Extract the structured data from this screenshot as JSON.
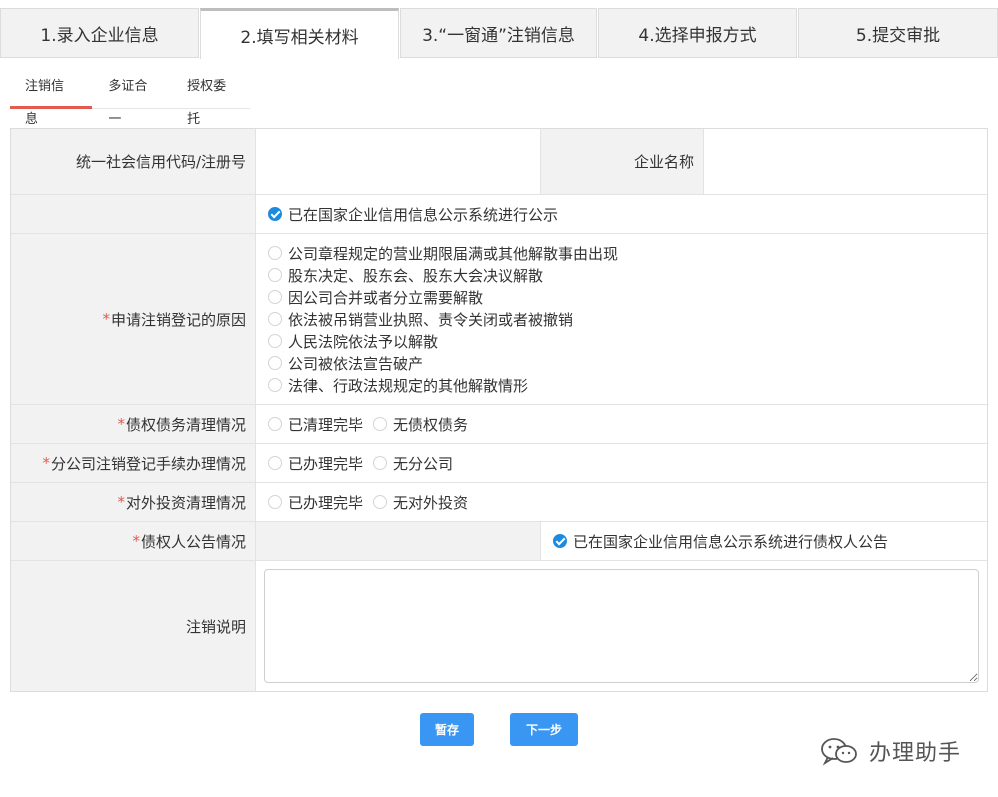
{
  "steps": [
    {
      "label": "1.录入企业信息"
    },
    {
      "label": "2.填写相关材料"
    },
    {
      "label": "3.“一窗通”注销信息"
    },
    {
      "label": "4.选择申报方式"
    },
    {
      "label": "5.提交审批"
    }
  ],
  "subtabs": [
    "注销信息",
    "多证合一",
    "授权委托"
  ],
  "form": {
    "credit_code_label": "统一社会信用代码/注册号",
    "credit_code_value": "",
    "company_name_label": "企业名称",
    "company_name_value": "",
    "publicity_option": "已在国家企业信用信息公示系统进行公示",
    "reason_label": "申请注销登记的原因",
    "reasons": [
      "公司章程规定的营业期限届满或其他解散事由出现",
      "股东决定、股东会、股东大会决议解散",
      "因公司合并或者分立需要解散",
      "依法被吊销营业执照、责令关闭或者被撤销",
      "人民法院依法予以解散",
      "公司被依法宣告破产",
      "法律、行政法规规定的其他解散情形"
    ],
    "debt_label": "债权债务清理情况",
    "debt_options": [
      "已清理完毕",
      "无债权债务"
    ],
    "branch_label": "分公司注销登记手续办理情况",
    "branch_options": [
      "已办理完毕",
      "无分公司"
    ],
    "invest_label": "对外投资清理情况",
    "invest_options": [
      "已办理完毕",
      "无对外投资"
    ],
    "creditor_label": "债权人公告情况",
    "creditor_option": "已在国家企业信用信息公示系统进行债权人公告",
    "note_label": "注销说明",
    "note_value": "",
    "required_mark": "*"
  },
  "buttons": {
    "save": "暂存",
    "next": "下一步"
  },
  "watermark": "办理助手",
  "colors": {
    "accent": "#3a96f3",
    "check": "#1b8be0",
    "required": "#e15b4f",
    "label_bg": "#f2f2f2"
  }
}
